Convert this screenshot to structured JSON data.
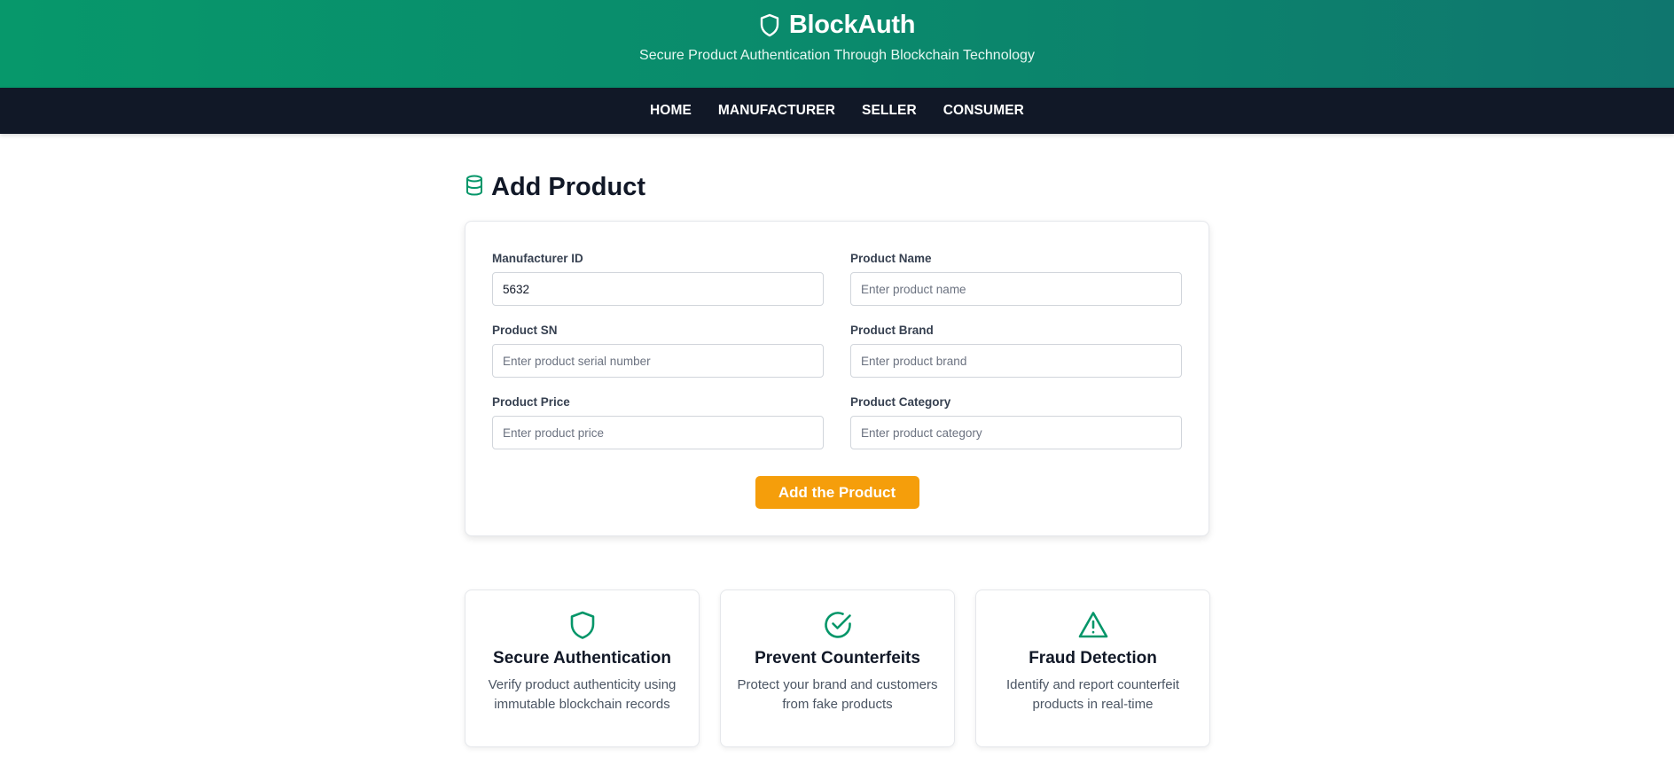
{
  "header": {
    "brand": "BlockAuth",
    "tagline": "Secure Product Authentication Through Blockchain Technology",
    "brand_icon": "shield-icon"
  },
  "nav": {
    "items": [
      {
        "label": "HOME"
      },
      {
        "label": "MANUFACTURER"
      },
      {
        "label": "SELLER"
      },
      {
        "label": "CONSUMER"
      }
    ]
  },
  "page": {
    "title": "Add Product",
    "title_icon": "database-icon"
  },
  "form": {
    "fields": {
      "manufacturer_id": {
        "label": "Manufacturer ID",
        "value": "5632",
        "placeholder": ""
      },
      "product_name": {
        "label": "Product Name",
        "value": "",
        "placeholder": "Enter product name"
      },
      "product_sn": {
        "label": "Product SN",
        "value": "",
        "placeholder": "Enter product serial number"
      },
      "product_brand": {
        "label": "Product Brand",
        "value": "",
        "placeholder": "Enter product brand"
      },
      "product_price": {
        "label": "Product Price",
        "value": "",
        "placeholder": "Enter product price"
      },
      "product_category": {
        "label": "Product Category",
        "value": "",
        "placeholder": "Enter product category"
      }
    },
    "submit_label": "Add the Product"
  },
  "features": [
    {
      "icon": "shield-icon",
      "title": "Secure Authentication",
      "description": "Verify product authenticity using immutable blockchain records"
    },
    {
      "icon": "check-circle-icon",
      "title": "Prevent Counterfeits",
      "description": "Protect your brand and customers from fake products"
    },
    {
      "icon": "warning-triangle-icon",
      "title": "Fraud Detection",
      "description": "Identify and report counterfeit products in real-time"
    }
  ],
  "colors": {
    "header_gradient_start": "#07986b",
    "header_gradient_end": "#0f766e",
    "nav_background": "#111827",
    "accent_green": "#059669",
    "button_orange": "#f59e0b"
  }
}
